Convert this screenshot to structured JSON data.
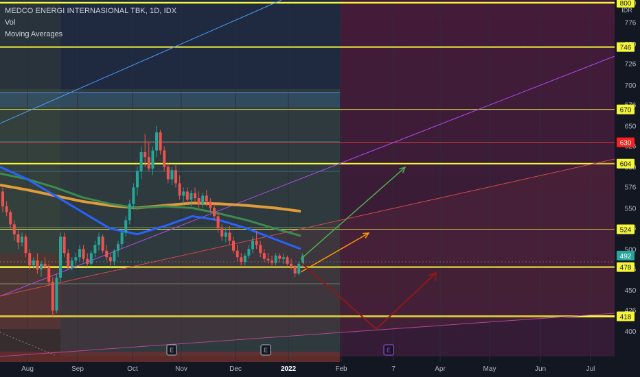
{
  "legend": {
    "title": "MEDCO ENERGI INTERNASIONAL TBK, 1D, IDX",
    "vol": "Vol",
    "ma": "Moving Averages"
  },
  "colors": {
    "background": "#131722",
    "level_line": "#f5f53a",
    "candle_up": "#26a69a",
    "candle_down": "#ef5350",
    "ma_orange": "#e09c3b",
    "ma_green": "#3d8b50",
    "ma_blue": "#2962ff",
    "current_price_badge": "#26a69a",
    "resistance_red": "#ff1f1f"
  },
  "chart_data": {
    "type": "candlestick",
    "symbol": "MEDCO ENERGI INTERNASIONAL TBK",
    "interval": "1D",
    "exchange": "IDX",
    "currency": "IDR",
    "y_range": [
      390,
      800
    ],
    "y_ticks": [
      400,
      426,
      450,
      476,
      500,
      526,
      550,
      576,
      600,
      626,
      650,
      676,
      700,
      726,
      750,
      776,
      800
    ],
    "price_labels": [
      {
        "value": 800,
        "text": "800",
        "style": "yellow"
      },
      {
        "value": 746,
        "text": "746",
        "style": "yellow"
      },
      {
        "value": 670,
        "text": "670",
        "style": "yellow"
      },
      {
        "value": 630,
        "text": "630",
        "style": "red"
      },
      {
        "value": 604,
        "text": "604",
        "style": "yellow"
      },
      {
        "value": 524,
        "text": "524",
        "style": "yellow"
      },
      {
        "value": 492,
        "text": "492",
        "style": "current"
      },
      {
        "value": 478,
        "text": "478",
        "style": "yellow"
      },
      {
        "value": 418,
        "text": "418",
        "style": "yellow"
      }
    ],
    "horizontal_levels": [
      {
        "value": 800,
        "color": "#f5f53a",
        "width": 2.5
      },
      {
        "value": 746,
        "color": "#f5f53a",
        "width": 2
      },
      {
        "value": 670,
        "color": "#d8d84a",
        "width": 1
      },
      {
        "value": 630,
        "color": "#d63a3a",
        "width": 1
      },
      {
        "value": 604,
        "color": "#f5f53a",
        "width": 2
      },
      {
        "value": 524,
        "color": "#d8d84a",
        "width": 1
      },
      {
        "value": 478,
        "color": "#f5f53a",
        "width": 2.5
      },
      {
        "value": 418,
        "color": "#f5f53a",
        "width": 3
      }
    ],
    "x_ticks": [
      "Aug",
      "Sep",
      "Oct",
      "Nov",
      "Dec",
      "2022",
      "Feb",
      "7",
      "Apr",
      "May",
      "Jun",
      "Jul"
    ],
    "event_markers": [
      "E",
      "E",
      "E"
    ],
    "current_price": 492,
    "candles": [
      [
        570,
        575,
        545,
        552
      ],
      [
        552,
        558,
        540,
        545
      ],
      [
        545,
        548,
        525,
        530
      ],
      [
        530,
        535,
        510,
        518
      ],
      [
        518,
        525,
        500,
        508
      ],
      [
        508,
        520,
        503,
        515
      ],
      [
        515,
        518,
        490,
        495
      ],
      [
        495,
        500,
        475,
        480
      ],
      [
        480,
        490,
        476,
        486
      ],
      [
        486,
        495,
        470,
        475
      ],
      [
        475,
        485,
        466,
        482
      ],
      [
        482,
        490,
        475,
        478
      ],
      [
        478,
        482,
        455,
        460
      ],
      [
        460,
        465,
        418,
        425
      ],
      [
        425,
        470,
        422,
        465
      ],
      [
        465,
        520,
        460,
        515
      ],
      [
        515,
        520,
        490,
        495
      ],
      [
        495,
        500,
        475,
        478
      ],
      [
        478,
        490,
        474,
        486
      ],
      [
        486,
        495,
        480,
        490
      ],
      [
        490,
        505,
        485,
        500
      ],
      [
        500,
        505,
        485,
        488
      ],
      [
        488,
        495,
        478,
        482
      ],
      [
        482,
        498,
        480,
        495
      ],
      [
        495,
        510,
        490,
        505
      ],
      [
        505,
        520,
        498,
        515
      ],
      [
        515,
        518,
        495,
        498
      ],
      [
        498,
        505,
        486,
        490
      ],
      [
        490,
        494,
        478,
        485
      ],
      [
        485,
        500,
        480,
        498
      ],
      [
        498,
        510,
        490,
        506
      ],
      [
        506,
        525,
        500,
        520
      ],
      [
        520,
        540,
        515,
        535
      ],
      [
        535,
        560,
        530,
        555
      ],
      [
        555,
        580,
        548,
        575
      ],
      [
        575,
        600,
        565,
        595
      ],
      [
        595,
        625,
        585,
        618
      ],
      [
        618,
        640,
        600,
        612
      ],
      [
        612,
        630,
        595,
        598
      ],
      [
        598,
        625,
        590,
        620
      ],
      [
        620,
        650,
        612,
        642
      ],
      [
        642,
        645,
        615,
        620
      ],
      [
        620,
        625,
        595,
        600
      ],
      [
        600,
        605,
        580,
        585
      ],
      [
        585,
        600,
        578,
        596
      ],
      [
        596,
        602,
        575,
        580
      ],
      [
        580,
        590,
        560,
        565
      ],
      [
        565,
        575,
        555,
        570
      ],
      [
        570,
        575,
        555,
        560
      ],
      [
        560,
        572,
        552,
        568
      ],
      [
        568,
        575,
        558,
        562
      ],
      [
        562,
        570,
        550,
        555
      ],
      [
        555,
        568,
        550,
        565
      ],
      [
        565,
        572,
        552,
        558
      ],
      [
        558,
        562,
        545,
        550
      ],
      [
        550,
        555,
        535,
        540
      ],
      [
        540,
        545,
        520,
        525
      ],
      [
        525,
        530,
        510,
        515
      ],
      [
        515,
        525,
        508,
        520
      ],
      [
        520,
        528,
        505,
        510
      ],
      [
        510,
        515,
        495,
        498
      ],
      [
        498,
        505,
        485,
        490
      ],
      [
        490,
        495,
        480,
        484
      ],
      [
        484,
        495,
        480,
        492
      ],
      [
        492,
        505,
        488,
        500
      ],
      [
        500,
        515,
        495,
        510
      ],
      [
        510,
        522,
        500,
        505
      ],
      [
        505,
        510,
        490,
        495
      ],
      [
        495,
        500,
        484,
        488
      ],
      [
        488,
        495,
        482,
        486
      ],
      [
        486,
        492,
        480,
        483
      ],
      [
        483,
        495,
        480,
        492
      ],
      [
        492,
        495,
        484,
        488
      ],
      [
        488,
        494,
        482,
        490
      ],
      [
        490,
        492,
        480,
        482
      ],
      [
        482,
        488,
        475,
        478
      ],
      [
        478,
        480,
        466,
        470
      ],
      [
        470,
        485,
        468,
        482
      ],
      [
        482,
        495,
        478,
        492
      ]
    ],
    "ma_orange": [
      [
        0,
        578
      ],
      [
        40,
        572
      ],
      [
        80,
        565
      ],
      [
        120,
        558
      ],
      [
        160,
        553
      ],
      [
        200,
        550
      ],
      [
        240,
        553
      ],
      [
        280,
        556
      ],
      [
        320,
        555
      ],
      [
        360,
        553
      ],
      [
        400,
        550
      ],
      [
        438,
        546
      ]
    ],
    "ma_green": [
      [
        0,
        592
      ],
      [
        40,
        585
      ],
      [
        80,
        575
      ],
      [
        120,
        563
      ],
      [
        160,
        555
      ],
      [
        200,
        550
      ],
      [
        240,
        552
      ],
      [
        280,
        550
      ],
      [
        320,
        543
      ],
      [
        360,
        535
      ],
      [
        400,
        525
      ],
      [
        438,
        516
      ]
    ],
    "ma_blue": [
      [
        0,
        600
      ],
      [
        40,
        585
      ],
      [
        80,
        565
      ],
      [
        120,
        545
      ],
      [
        160,
        525
      ],
      [
        200,
        518
      ],
      [
        240,
        528
      ],
      [
        280,
        540
      ],
      [
        320,
        535
      ],
      [
        360,
        525
      ],
      [
        400,
        512
      ],
      [
        438,
        500
      ]
    ]
  }
}
